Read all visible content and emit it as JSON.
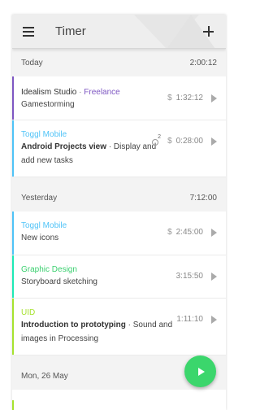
{
  "appbar": {
    "title": "Timer"
  },
  "colors": {
    "purple": "#7e57c2",
    "blue": "#4fc3f7",
    "teal": "#1de9b6",
    "green": "#3cd070",
    "lime": "#a6e22e",
    "fab": "#3bd66c"
  },
  "days": [
    {
      "label": "Today",
      "total": "2:00:12",
      "entries": [
        {
          "project": "Idealism Studio",
          "client": "Freelance",
          "description": "Gamestorming",
          "duration": "1:32:12",
          "billable": true
        },
        {
          "project": "Toggl Mobile",
          "description_bold": "Android Projects view",
          "description_rest": "Display and add new tasks",
          "duration": "0:28:00",
          "billable": true,
          "count": "2"
        }
      ]
    },
    {
      "label": "Yesterday",
      "total": "7:12:00",
      "entries": [
        {
          "project": "Toggl Mobile",
          "description": "New icons",
          "duration": "2:45:00",
          "billable": true
        },
        {
          "project": "Graphic Design",
          "description": "Storyboard sketching",
          "duration": "3:15:50",
          "billable": false
        },
        {
          "project": "UID",
          "description_bold": "Introduction to prototyping",
          "description_rest": "Sound and images in Processing",
          "duration": "1:11:10",
          "billable": false
        }
      ]
    },
    {
      "label": "Mon, 26 May"
    }
  ],
  "icons": {
    "menu": "hamburger-menu-icon",
    "add": "plus-icon",
    "billable": "dollar-icon",
    "subtasks": "subtask-count-icon",
    "continue": "play-icon",
    "fab": "play-icon"
  }
}
